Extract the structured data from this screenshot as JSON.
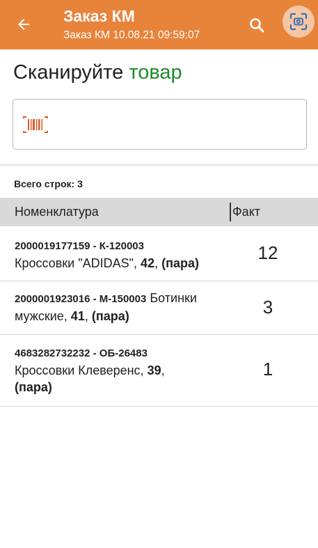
{
  "appbar": {
    "title": "Заказ КМ",
    "subtitle": "Заказ КМ 10.08.21 09:59:07",
    "color": "#e8833a"
  },
  "prompt": {
    "text": "Сканируйте",
    "accent": "товар",
    "accent_color": "#1f8a2e"
  },
  "scan_field": {
    "value": "",
    "icon": "barcode-icon"
  },
  "summary": {
    "row_count": "Всего строк: 3"
  },
  "table": {
    "columns": [
      "Номенклатура",
      "Факт"
    ],
    "rows": [
      {
        "code": "2000019177159 - К-120003",
        "name": "Кроссовки \"ADIDAS\"",
        "size": "42",
        "unit": "(пара)",
        "qty": "12"
      },
      {
        "code": "2000001923016 - М-150003",
        "name": "Ботинки мужские",
        "size": "41",
        "unit": "(пара)",
        "qty": "3"
      },
      {
        "code": "4683282732232 - ОБ-26483",
        "name": "Кроссовки Клеверенс",
        "size": "39",
        "unit": "(пара)",
        "qty": "1"
      }
    ]
  }
}
